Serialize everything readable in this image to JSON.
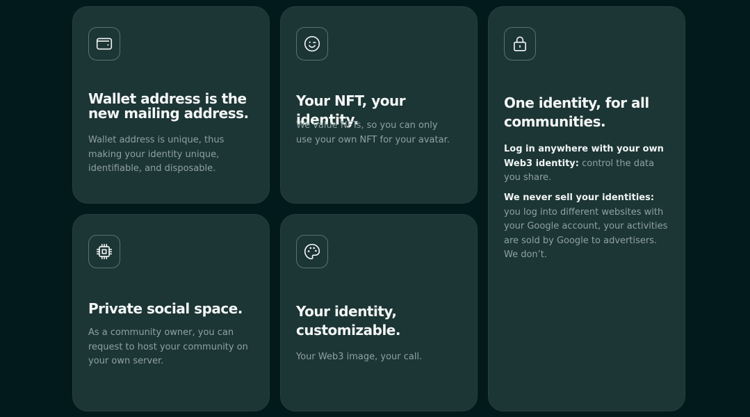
{
  "cards": {
    "wallet": {
      "title": "Wallet address is the new mailing address.",
      "desc": "Wallet address is unique, thus making your identity unique, identifiable, and disposable."
    },
    "nft": {
      "title": "Your NFT, your identity.",
      "desc": "We value NFTs, so you can only use your own NFT for your avatar."
    },
    "communities": {
      "title": "One identity, for all communities.",
      "p1_bold": "Log in anywhere with your own Web3 identity:",
      "p1_text": " control the data you share.",
      "p2_bold": "We never sell your identities:",
      "p2_text": " you log into different websites with your Google account, your activities are sold by Google to advertisers. We don’t."
    },
    "private": {
      "title": "Private social space.",
      "desc": "As a community owner, you can request to host your community on your own server."
    },
    "custom": {
      "title": "Your identity, customizable.",
      "desc": "Your Web3 image, your call."
    }
  },
  "icons": {
    "wallet": "wallet-icon",
    "nft": "wink-face-icon",
    "communities": "lock-icon",
    "private": "chip-icon",
    "custom": "palette-icon"
  },
  "colors": {
    "background": "#021a1c",
    "card": "#1c3535",
    "title": "#f3f6f5",
    "body": "#8fa3a2"
  }
}
